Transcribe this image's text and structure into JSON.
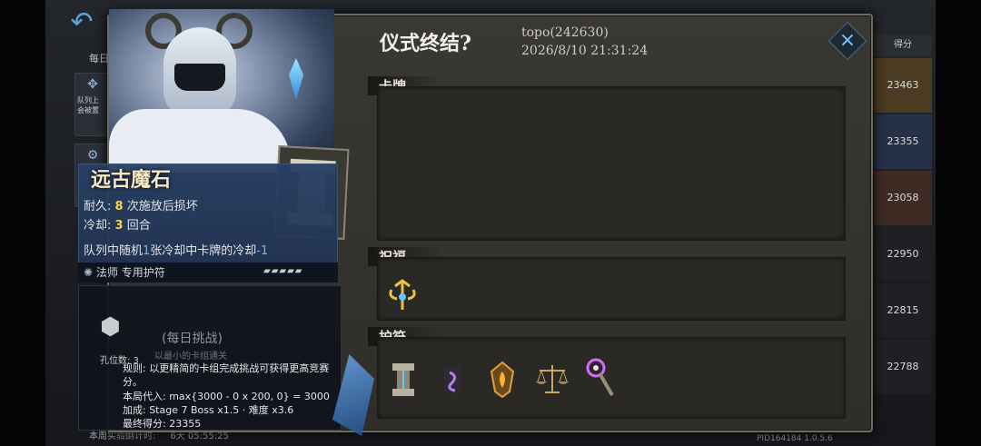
{
  "background": {
    "daily_label": "每日",
    "tile1_text": "队列上\n会被置",
    "countdown_label": "本周实验倒计时:",
    "countdown_value": "6天 05:55:25",
    "pid_version": "PID164184  1.0.5.6",
    "score_header": "得分",
    "scores": [
      "23463",
      "23355",
      "23058",
      "22950",
      "22815",
      "22788"
    ],
    "score_colors": [
      "#4a3b22",
      "#263047",
      "#3e2b23",
      "#1e2024",
      "#1e2024",
      "#1e2024"
    ]
  },
  "dialog": {
    "title": "仪式终结?",
    "player": "topo(242630)",
    "timestamp": "2026/8/10 21:31:24",
    "close_label": "×",
    "sections": {
      "cards": "卡牌",
      "blessing": "祝福",
      "amulets": "护符"
    },
    "blessing_icons": [
      "winged-trident-icon"
    ],
    "amulet_icons": [
      "stone-pillar-icon",
      "purple-rune-stone-icon",
      "golden-flame-shield-icon",
      "scales-icon",
      "purple-staff-icon"
    ]
  },
  "card": {
    "name": "远古魔石",
    "durability_label": "耐久:",
    "durability_value": "8",
    "durability_suffix": "次施放后损坏",
    "cooldown_label": "冷却:",
    "cooldown_value": "3",
    "cooldown_suffix": "回合",
    "effect_prefix": "队列中随机",
    "effect_count": "1",
    "effect_mid": "张冷却中卡牌的冷却",
    "effect_value": "-1",
    "class_line": "法师 专用护符",
    "pips": "▰▰▰▰▰"
  },
  "challenge": {
    "slots_label": "孔位数: 3",
    "title": "(每日挑战)",
    "subtitle": "以最小的卡组通关",
    "rule": "规则: 以更精简的卡组完成挑战可获得更高竞赛分。",
    "calc": "本局代入: max{3000 - 0 x 200, 0} = 3000",
    "bonus": "加成: Stage 7 Boss x1.5 · 难度 x3.6",
    "final": "最终得分: 23355"
  }
}
